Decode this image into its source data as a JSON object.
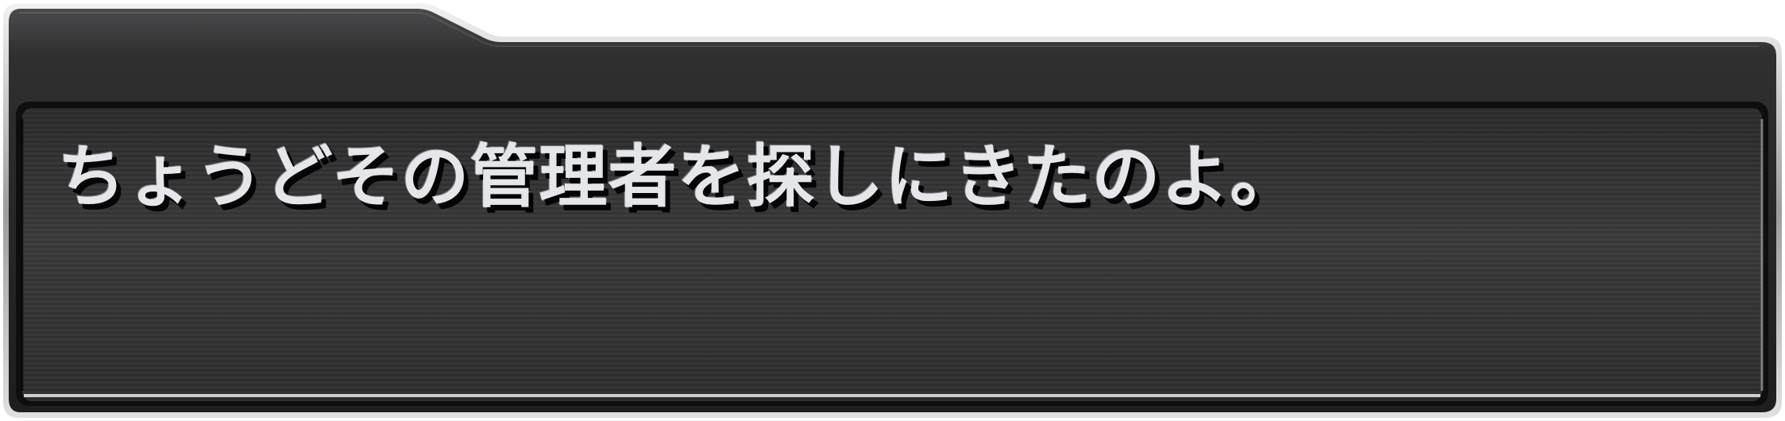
{
  "dialogue": {
    "text": "ちょうどその管理者を探しにきたのよ。"
  },
  "colors": {
    "panel_dark": "#2a2a2b",
    "panel_light": "#3a3a3b",
    "border_silver": "#d4d4d6",
    "text_main": "#e4e6ea",
    "text_shadow": "#050505"
  }
}
